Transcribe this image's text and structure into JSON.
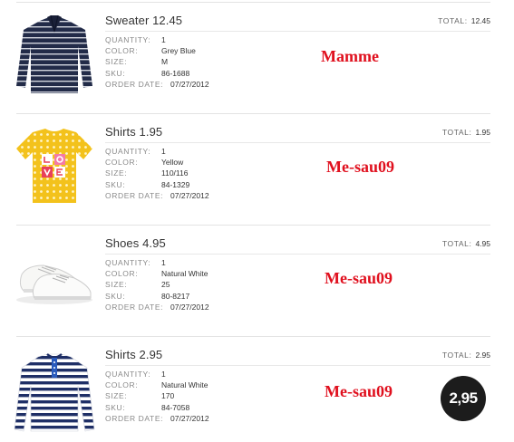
{
  "labels": {
    "quantity": "QUANTITY:",
    "color": "COLOR:",
    "size": "SIZE:",
    "sku": "SKU:",
    "order_date": "ORDER DATE:",
    "total": "TOTAL:"
  },
  "items": [
    {
      "title": "Sweater 12.45",
      "total": "12.45",
      "quantity": "1",
      "color": "Grey Blue",
      "size": "M",
      "sku": "86-1688",
      "order_date": "07/27/2012",
      "annotation": "Mamme",
      "image_icon": "navy-striped-sweater-icon"
    },
    {
      "title": "Shirts 1.95",
      "total": "1.95",
      "quantity": "1",
      "color": "Yellow",
      "size": "110/116",
      "sku": "84-1329",
      "order_date": "07/27/2012",
      "annotation": "Me-sau09",
      "image_icon": "yellow-love-tshirt-icon"
    },
    {
      "title": "Shoes 4.95",
      "total": "4.95",
      "quantity": "1",
      "color": "Natural White",
      "size": "25",
      "sku": "80-8217",
      "order_date": "07/27/2012",
      "annotation": "Me-sau09",
      "image_icon": "white-sneakers-icon"
    },
    {
      "title": "Shirts 2.95",
      "total": "2.95",
      "quantity": "1",
      "color": "Natural White",
      "size": "170",
      "sku": "84-7058",
      "order_date": "07/27/2012",
      "annotation": "Me-sau09",
      "image_icon": "striped-henley-shirt-icon"
    }
  ],
  "price_badge": "2,95",
  "colors": {
    "annotation_red": "#e0101e",
    "badge_bg": "#1c1c1c",
    "divider": "#e3e3e3"
  }
}
